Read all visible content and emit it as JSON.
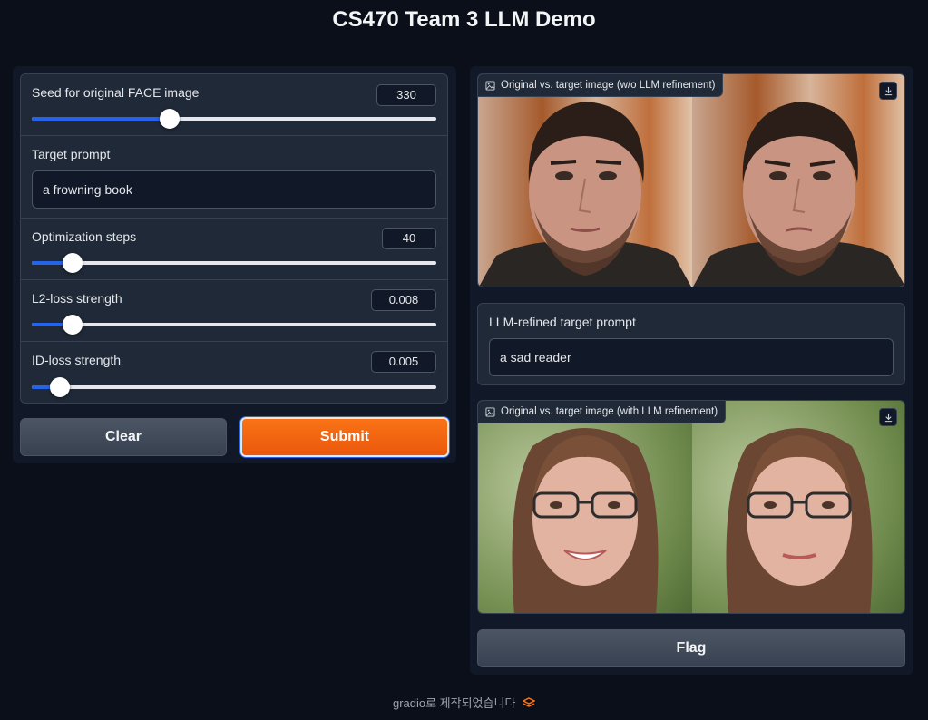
{
  "app": {
    "title": "CS470 Team 3 LLM Demo"
  },
  "inputs": {
    "seed": {
      "label": "Seed for original FACE image",
      "value": "330",
      "fraction": 0.34
    },
    "target_prompt": {
      "label": "Target prompt",
      "value": "a frowning book"
    },
    "steps": {
      "label": "Optimization steps",
      "value": "40",
      "fraction": 0.1
    },
    "l2": {
      "label": "L2-loss strength",
      "value": "0.008",
      "fraction": 0.1
    },
    "id": {
      "label": "ID-loss strength",
      "value": "0.005",
      "fraction": 0.07
    }
  },
  "buttons": {
    "clear": "Clear",
    "submit": "Submit",
    "flag": "Flag"
  },
  "outputs": {
    "image1_label": "Original vs. target image (w/o LLM refinement)",
    "refined_label": "LLM-refined target prompt",
    "refined_value": "a sad reader",
    "image2_label": "Original vs. target image (with LLM refinement)"
  },
  "footer": {
    "text": "gradio로 제작되었습니다"
  },
  "colors": {
    "accent": "#2563eb",
    "submit": "#f97316",
    "background": "#0b0f19",
    "panel": "#1f2937"
  },
  "icons": [
    "image-icon",
    "download-icon",
    "gradio-logo-icon"
  ]
}
